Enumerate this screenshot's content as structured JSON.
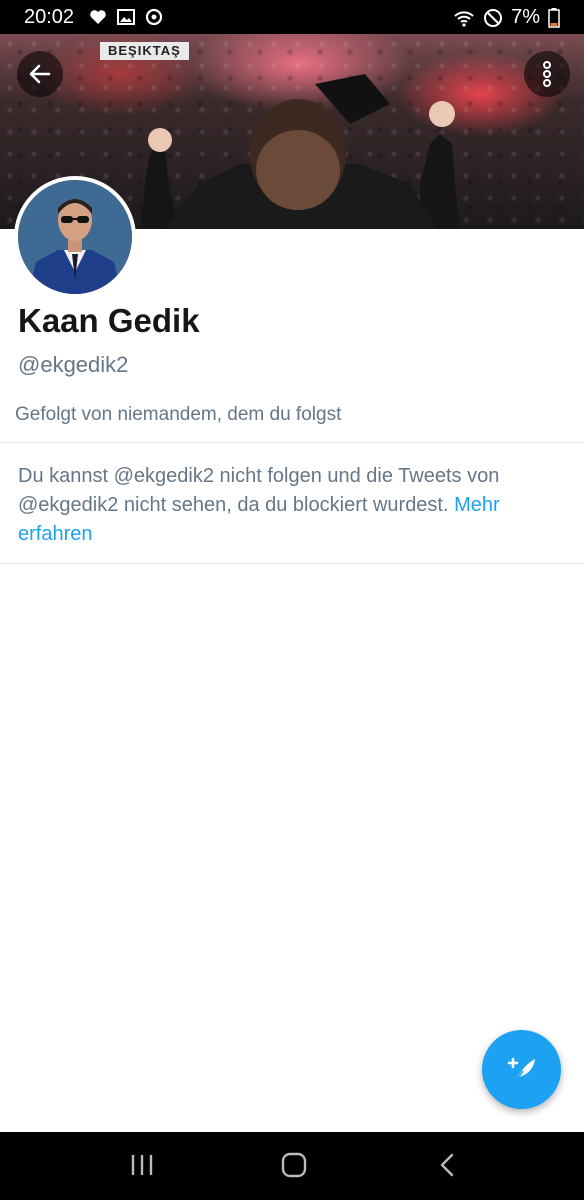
{
  "status_bar": {
    "time": "20:02",
    "battery": "7%",
    "left_icons": [
      "heart-icon",
      "image-icon",
      "sync-icon"
    ],
    "right_icons": [
      "wifi-icon",
      "do-not-disturb-icon",
      "battery-icon"
    ]
  },
  "banner": {
    "sign_text": "BEŞIKTAŞ"
  },
  "profile": {
    "name": "Kaan Gedik",
    "handle": "@ekgedik2",
    "followed_by": "Gefolgt von niemandem, dem du folgst"
  },
  "block_notice": {
    "text": "Du kannst @ekgedik2 nicht folgen und die Tweets von @ekgedik2 nicht sehen, da du blockiert wurdest.",
    "link_label": "Mehr erfahren"
  },
  "colors": {
    "accent": "#1da1f2",
    "secondary_text": "#657786",
    "primary_text": "#14171a"
  },
  "nav_icons": [
    "recent-apps-icon",
    "home-icon",
    "back-nav-icon"
  ]
}
